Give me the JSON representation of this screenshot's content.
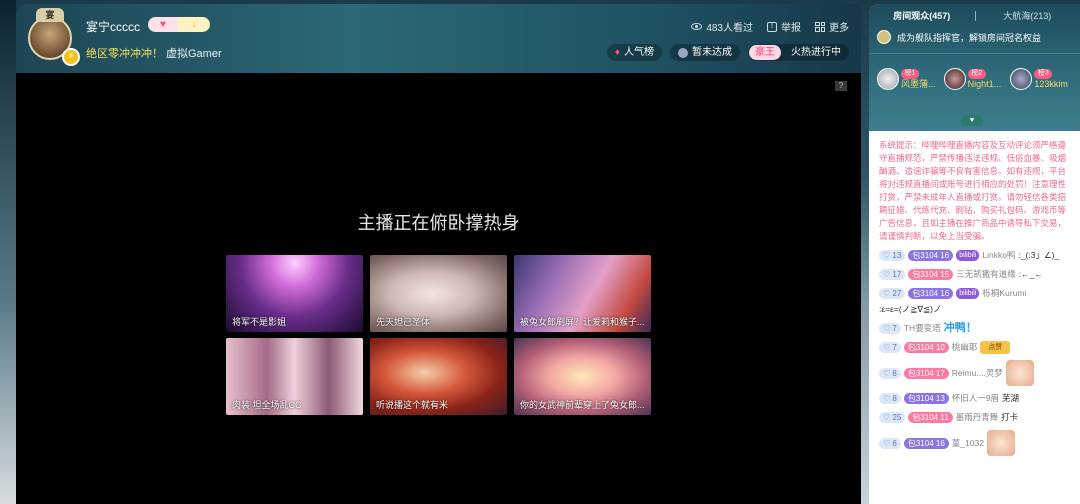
{
  "header": {
    "anchor_name": "宴宁ccccc",
    "crown_text": "宴",
    "slogan": "绝区零冲冲冲！",
    "category": "虚拟Gamer",
    "viewers": "483人看过",
    "report": "举报",
    "more": "更多",
    "popularity": "人气榜",
    "goal": "暂未达成",
    "king_badge": "豪王",
    "hot": "火热进行中"
  },
  "stage": {
    "title": "主播正在俯卧撑热身",
    "help": "?",
    "cards": [
      {
        "label": "将军不是影姐",
        "color": "#6a2d8c"
      },
      {
        "label": "先天妲己圣体",
        "color": "#cdb7b2"
      },
      {
        "label": "被兔女郎刷屏？让爱莉和猴子...",
        "color": "#9c6fb5"
      },
      {
        "label": "肉装 坦全场乱CC",
        "color": "#a46b87"
      },
      {
        "label": "听说播这个就有米",
        "color": "#d4583b"
      },
      {
        "label": "你的女武神前辈穿上了兔女郎...",
        "color": "#f2a6a3"
      }
    ]
  },
  "sidebar": {
    "tab_audience": "房间观众(457)",
    "tab_fleet": "大航海(213)",
    "guard_text": "成为舰队指挥官，解锁房间冠名权益",
    "top_users": [
      {
        "rank": "榜1",
        "name": "风墨蒲..."
      },
      {
        "rank": "榜2",
        "name": "Night1..."
      },
      {
        "rank": "榜3",
        "name": "123kkim"
      }
    ],
    "expand_icon": "chevron-down",
    "notice": "系统提示：哔哩哔哩直播内容及互动评论须严格遵守直播规范，严禁传播违法违规、低俗血暴、吸烟酗酒、造谣诈骗等不良有害信息。如有违规，平台将对违规直播间或账号进行相应的处罚！注意理性打赏，严禁未成年人直播或打赏。请勿轻信各类招聘征婚、代练代充、刷钻、购买礼包码、游戏币等广告信息，且如主播在推广商品中诱导私下交易，请谨慎判断，以免上当受骗。",
    "messages": [
      {
        "lv": "13",
        "fan": "包3104",
        "fan_lv": "16",
        "bili": "bilibili",
        "user": "Linkko鸭",
        "text": ":_(:3」∠)_"
      },
      {
        "lv": "17",
        "fan": "包3104",
        "fan_lv": "15",
        "bili": "",
        "user": "三无凯撒有道缘",
        "text": ":←_←"
      },
      {
        "lv": "27",
        "fan": "包3104",
        "fan_lv": "16",
        "bili": "bilibili",
        "user": "栎桐Kurumi",
        "text": ":ε=ε=(ノ≧∇≦)ノ"
      },
      {
        "lv": "7",
        "fan": "",
        "fan_lv": "",
        "bili": "",
        "user": "TH要变塔",
        "text": "冲鸭！"
      },
      {
        "lv": "7",
        "fan": "包3104",
        "fan_lv": "10",
        "bili": "",
        "user": "桃幽耶",
        "text": "点赞"
      },
      {
        "lv": "8",
        "fan": "包3104",
        "fan_lv": "17",
        "bili": "",
        "user": "Reimu....灵梦",
        "text": ""
      },
      {
        "lv": "8",
        "fan": "包3104",
        "fan_lv": "13",
        "bili": "",
        "user": "怀旧人一9眉",
        "text": "芜湖"
      },
      {
        "lv": "25",
        "fan": "包3104",
        "fan_lv": "11",
        "bili": "",
        "user": "墨雨丹青舞",
        "text": "打卡"
      },
      {
        "lv": "6",
        "fan": "包3104",
        "fan_lv": "16",
        "bili": "",
        "user": "菫_1032",
        "text": ""
      }
    ]
  }
}
